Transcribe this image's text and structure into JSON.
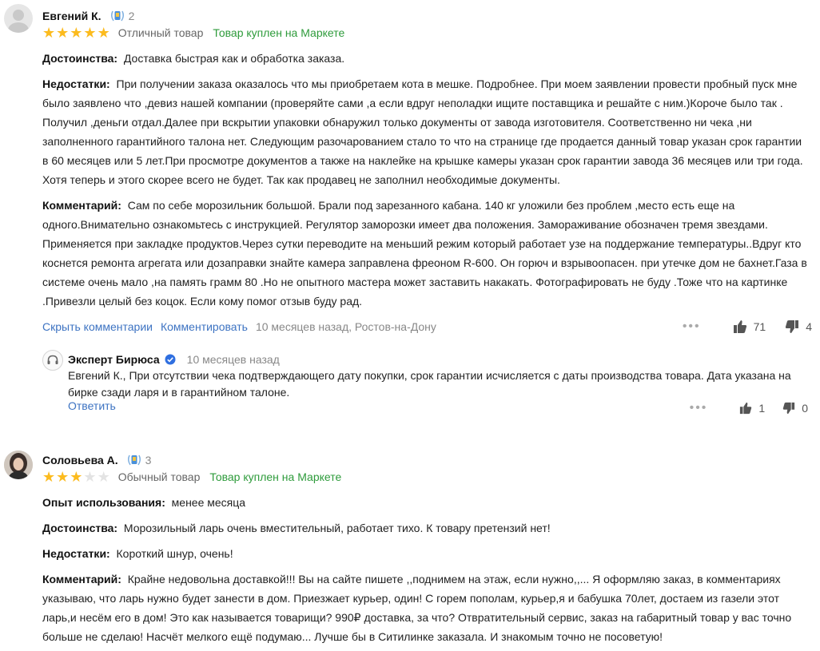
{
  "reviews": [
    {
      "author": "Евгений К.",
      "level": "2",
      "rating": 5,
      "verdict": "Отличный товар",
      "purchase_badge": "Товар куплен на Маркете",
      "pros_label": "Достоинства:",
      "pros": "Доставка быстрая как и обработка заказа.",
      "cons_label": "Недостатки:",
      "cons_lines": [
        "При получении заказа оказалось что мы приобретаем кота в мешке. Подробнее. При моем заявлении провести пробный пуск мне",
        "было заявлено что ,девиз нашей компании (проверяйте сами ,а если вдруг неполадки ищите поставщика и решайте с ним.)Короче было так .",
        "Получил ,деньги отдал.Далее при вскрытии упаковки обнаружил только документы от завода изготовителя. Соответственно ни чека ,ни",
        "заполненного гарантийного талона нет. Следующим разочарованием стало то что на странице где продается данный товар указан срок гарантии",
        "в 60 месяцев или 5 лет.При просмотре документов а также на наклейке на крышке камеры указан срок гарантии завода 36 месяцев или три года.",
        "Хотя теперь и этого скорее всего не будет. Так как продавец не заполнил необходимые документы."
      ],
      "comment_label": "Комментарий:",
      "comment_lines": [
        "Сам по себе морозильник большой. Брали под зарезанного кабана. 140 кг уложили без проблем ,место есть еще на",
        "одного.Внимательно ознакомьтесь с инструкцией. Регулятор заморозки имеет два положения. Замораживание обозначен тремя звездами.",
        "Применяется при закладке продуктов.Через сутки переводите на меньший режим который работает узе на поддержание температуры..Вдруг кто",
        "коснется ремонта агрегата или дозаправки знайте камера заправлена фреоном R-600. Он горюч и взрывоопасен. при утечке дом не бахнет.Газа в",
        "системе очень мало ,на память грамм 80 .Но не опытного мастера может заставить накакать. Фотографировать не буду .Тоже что на картинке",
        ".Привезли целый без коцок. Если кому помог отзыв буду рад."
      ],
      "hide_comments": "Скрыть комментарии",
      "comment_action": "Комментировать",
      "meta": "10 месяцев назад, Ростов-на-Дону",
      "likes": "71",
      "dislikes": "4",
      "reply": {
        "author": "Эксперт Бирюса",
        "date": "10 месяцев назад",
        "text_lines": [
          "Евгений К., При отсутствии чека подтверждающего дату покупки, срок гарантии исчисляется с даты производства товара. Дата указана на",
          "бирке сзади ларя и в гарантийном талоне."
        ],
        "answer": "Ответить",
        "likes": "1",
        "dislikes": "0"
      }
    },
    {
      "author": "Соловьева А.",
      "level": "3",
      "rating": 3,
      "verdict": "Обычный товар",
      "purchase_badge": "Товар куплен на Маркете",
      "usage_label": "Опыт использования:",
      "usage": "менее месяца",
      "pros_label": "Достоинства:",
      "pros": "Морозильный ларь очень вместительный, работает тихо. К товару претензий нет!",
      "cons_label": "Недостатки:",
      "cons": "Короткий шнур, очень!",
      "comment_label": "Комментарий:",
      "comment_lines": [
        "Крайне недовольна доставкой!!! Вы на сайте пишете ,,поднимем на этаж, если нужно,,... Я оформляю заказ, в комментариях",
        "указываю, что ларь нужно будет занести в дом. Приезжает курьер, один! С горем пополам, курьер,я и бабушка 70лет, достаем из газели этот",
        "ларь,и несём его в дом! Это как называется товарищи? 990₽ доставка, за что? Отвратительный сервис, заказ на габаритный товар у вас точно",
        "больше не сделаю! Насчёт мелкого ещё подумаю... Лучше бы в Ситилинке заказала. И знакомым точно не посоветую!"
      ]
    }
  ],
  "colors": {
    "star": "#fcbb1e",
    "link": "#3d73c2",
    "green": "#2e9b3b"
  }
}
